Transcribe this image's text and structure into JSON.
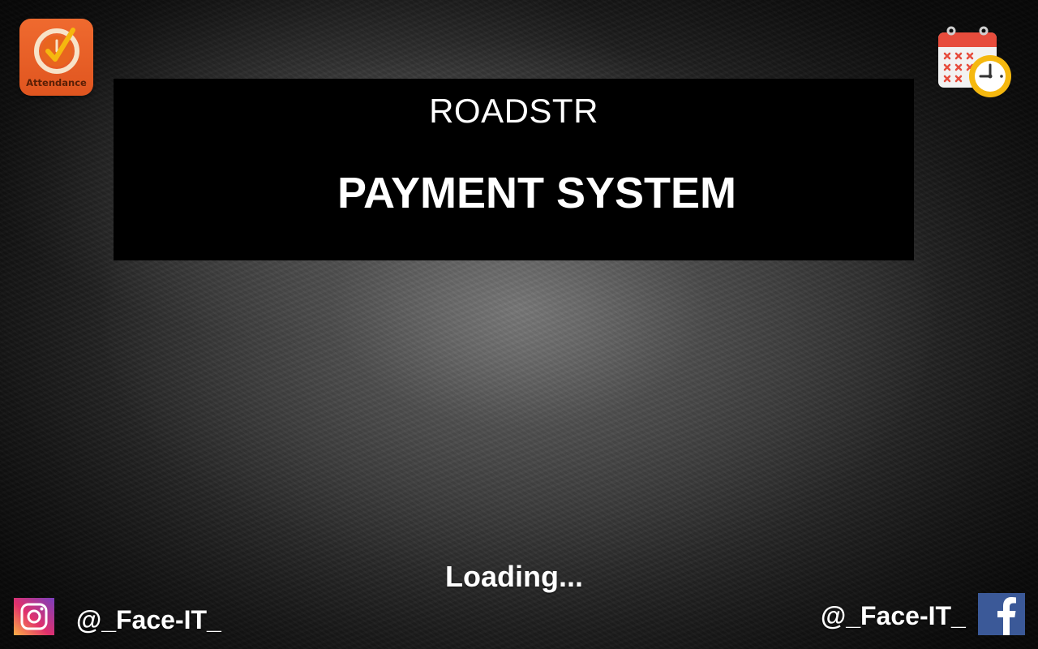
{
  "app_icon": {
    "label": "Attendance",
    "color": "#e65a22",
    "icon": "attendance-clock-check-icon"
  },
  "calendar_icon": {
    "icon": "calendar-clock-icon"
  },
  "header": {
    "company": "ROADSTR",
    "title": "PAYMENT SYSTEM",
    "background": "#000000"
  },
  "status": {
    "loading_text": "Loading..."
  },
  "social": {
    "instagram": {
      "icon": "instagram-icon",
      "handle": "@_Face-IT_"
    },
    "facebook": {
      "icon": "facebook-icon",
      "handle": "@_Face-IT_",
      "color": "#3b5998"
    }
  }
}
